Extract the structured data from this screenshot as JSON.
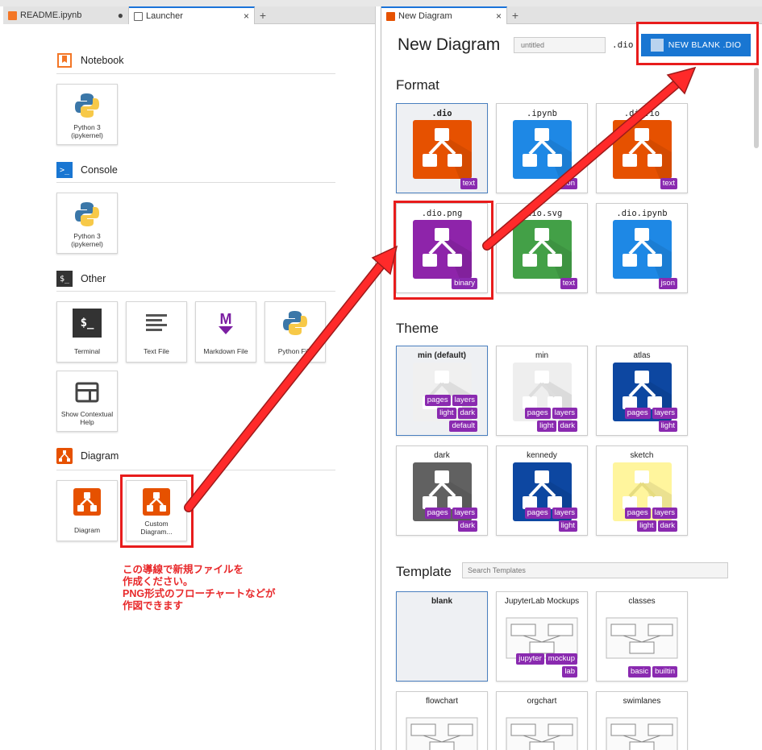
{
  "left_tabs": [
    {
      "label": "README.ipynb",
      "icon": "notebook-icon",
      "state": "●"
    },
    {
      "label": "Launcher",
      "icon": "launcher-icon",
      "close": "×"
    }
  ],
  "tab_add": "+",
  "sections": {
    "notebook": {
      "title": "Notebook",
      "items": [
        {
          "label": "Python 3 (ipykernel)"
        }
      ]
    },
    "console": {
      "title": "Console",
      "items": [
        {
          "label": "Python 3 (ipykernel)"
        }
      ]
    },
    "other": {
      "title": "Other",
      "items": [
        {
          "label": "Terminal"
        },
        {
          "label": "Text File"
        },
        {
          "label": "Markdown File"
        },
        {
          "label": "Python File"
        },
        {
          "label": "Show Contextual Help"
        }
      ]
    },
    "diagram": {
      "title": "Diagram",
      "items": [
        {
          "label": "Diagram"
        },
        {
          "label": "Custom Diagram..."
        }
      ]
    }
  },
  "icon_glyphs": {
    "console": ">_",
    "other": "$_",
    "terminal": "$_",
    "markdown": "M"
  },
  "right_tab": {
    "label": "New Diagram",
    "close": "×"
  },
  "header": {
    "title": "New Diagram",
    "filename_placeholder": "untitled",
    "extension": ".dio",
    "new_button": "NEW BLANK .DIO"
  },
  "format": {
    "title": "Format",
    "cards": [
      {
        "label": ".dio",
        "color": "#e65100",
        "badges": [
          [
            "text"
          ]
        ],
        "selected": true
      },
      {
        "label": ".ipynb",
        "color": "#1e88e5",
        "badges": [
          [
            "json"
          ]
        ]
      },
      {
        "label": ".dio.io",
        "color": "#e65100",
        "badges": [
          [
            "text"
          ]
        ]
      },
      {
        "label": ".dio.png",
        "color": "#8e24aa",
        "badges": [
          [
            "binary"
          ]
        ]
      },
      {
        "label": ".dio.svg",
        "color": "#43a047",
        "badges": [
          [
            "text"
          ]
        ]
      },
      {
        "label": ".dio.ipynb",
        "color": "#1e88e5",
        "badges": [
          [
            "json"
          ]
        ]
      }
    ]
  },
  "theme": {
    "title": "Theme",
    "cards": [
      {
        "label": "min (default)",
        "color": "#f0f0f0",
        "badges": [
          [
            "pages",
            "layers"
          ],
          [
            "light",
            "dark"
          ],
          [
            "default"
          ]
        ],
        "selected": true
      },
      {
        "label": "min",
        "color": "#eeeeee",
        "badges": [
          [
            "pages",
            "layers"
          ],
          [
            "light",
            "dark"
          ]
        ]
      },
      {
        "label": "atlas",
        "color": "#0d47a1",
        "badges": [
          [
            "pages",
            "layers"
          ],
          [
            "light"
          ]
        ]
      },
      {
        "label": "dark",
        "color": "#616161",
        "badges": [
          [
            "pages",
            "layers"
          ],
          [
            "dark"
          ]
        ]
      },
      {
        "label": "kennedy",
        "color": "#0d47a1",
        "badges": [
          [
            "pages",
            "layers"
          ],
          [
            "light"
          ]
        ]
      },
      {
        "label": "sketch",
        "color": "#fff59d",
        "badges": [
          [
            "pages",
            "layers"
          ],
          [
            "light",
            "dark"
          ]
        ]
      }
    ]
  },
  "template": {
    "title": "Template",
    "search_placeholder": "Search Templates",
    "cards": [
      {
        "label": "blank",
        "badges": [],
        "selected": true
      },
      {
        "label": "JupyterLab Mockups",
        "badges": [
          [
            "jupyter",
            "mockup"
          ],
          [
            "lab"
          ]
        ]
      },
      {
        "label": "classes",
        "badges": [
          [
            "basic",
            "builtin"
          ]
        ]
      },
      {
        "label": "flowchart",
        "badges": []
      },
      {
        "label": "orgchart",
        "badges": []
      },
      {
        "label": "swimlanes",
        "badges": []
      }
    ]
  },
  "annotation": {
    "line1": "この導線で新規ファイルを",
    "line2": "作成ください。",
    "line3": "PNG形式のフローチャートなどが",
    "line4": "作図できます"
  },
  "colors": {
    "accent": "#1976d2",
    "annotation": "#e8282a",
    "badge": "#8a2ab0",
    "diagram_orange": "#e65100"
  }
}
